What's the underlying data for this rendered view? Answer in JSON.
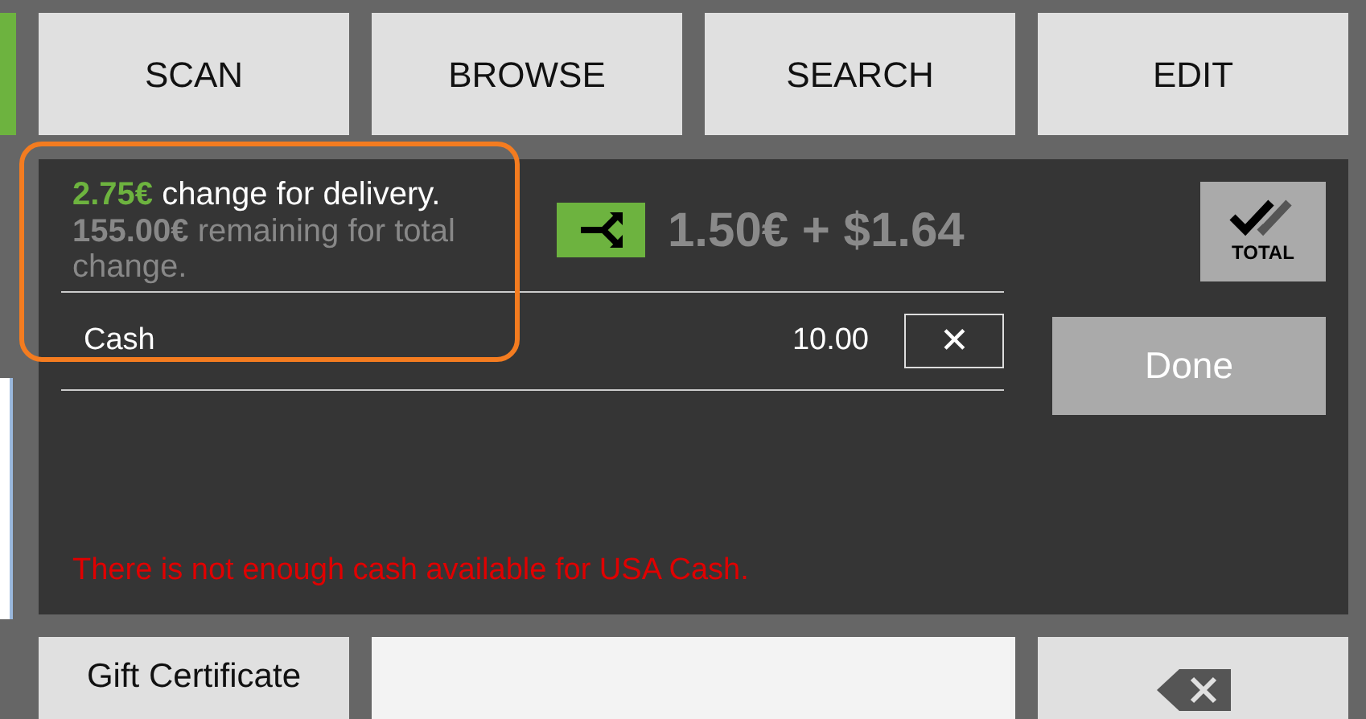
{
  "top_buttons": [
    {
      "label": "SCAN"
    },
    {
      "label": "BROWSE"
    },
    {
      "label": "SEARCH"
    },
    {
      "label": "EDIT"
    }
  ],
  "change": {
    "delivery_amount": "2.75€",
    "delivery_text": "change for delivery.",
    "remaining_amount": "155.00€",
    "remaining_text": "remaining for total change.",
    "split_amount": "1.50€ + $1.64"
  },
  "payments": [
    {
      "method": "Cash",
      "amount": "10.00",
      "remove": "✕"
    }
  ],
  "total_button": {
    "label": "TOTAL"
  },
  "done_button": {
    "label": "Done"
  },
  "error": "There is not enough cash available for USA Cash.",
  "bottom": {
    "gift_button": "Gift Certificate"
  }
}
